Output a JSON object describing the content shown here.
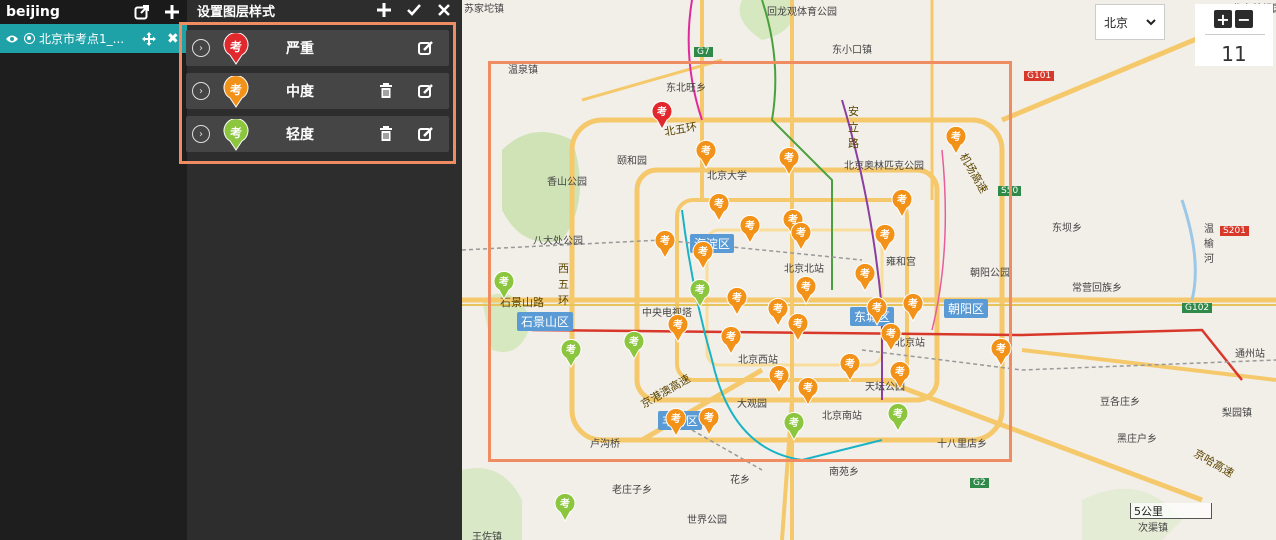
{
  "left_panel": {
    "title": "beijing",
    "layers": [
      {
        "name": "北京市考点1_...",
        "visible": true
      }
    ]
  },
  "style_panel": {
    "title": "设置图层样式",
    "rows": [
      {
        "label": "严重",
        "marker_glyph": "考",
        "color": "#e0282d",
        "deletable": false
      },
      {
        "label": "中度",
        "marker_glyph": "考",
        "color": "#f39219",
        "deletable": true
      },
      {
        "label": "轻度",
        "marker_glyph": "考",
        "color": "#8cc63f",
        "deletable": true
      }
    ]
  },
  "map": {
    "city_select": "北京",
    "zoom_level": "11",
    "scale_label": "5公里",
    "districts": [
      "海淀区",
      "石景山区",
      "朝阳区",
      "东城区",
      "丰台区"
    ],
    "road_labels": [
      "北五环",
      "京港澳高速",
      "京哈高速",
      "石景山路",
      "西五环",
      "安立路",
      "机场高速"
    ],
    "place_labels": [
      "苏家坨镇",
      "回龙观体育公园",
      "东小口镇",
      "温泉镇",
      "东北旺乡",
      "颐和园",
      "北京大学",
      "北京奥林匹克公园",
      "香山公园",
      "八大处公园",
      "北京北站",
      "雍和宫",
      "朝阳公园",
      "东坝乡",
      "常营回族乡",
      "中央电视塔",
      "北京站",
      "北京西站",
      "天坛公园",
      "大观园",
      "北京南站",
      "卢沟桥",
      "十八里店乡",
      "豆各庄乡",
      "黑庄户乡",
      "南苑乡",
      "老庄子乡",
      "花乡",
      "世界公园",
      "王佐镇",
      "次渠镇",
      "通州站",
      "梨园镇",
      "温榆河",
      "北京首都国际"
    ],
    "highway_shields": [
      "G7",
      "G101",
      "S50",
      "S201",
      "G102",
      "G2"
    ],
    "icons": [
      "eye-icon",
      "export-icon",
      "plus-icon",
      "check-icon",
      "close-icon",
      "move-icon",
      "trash-icon",
      "edit-icon",
      "chevron-down-icon"
    ]
  }
}
